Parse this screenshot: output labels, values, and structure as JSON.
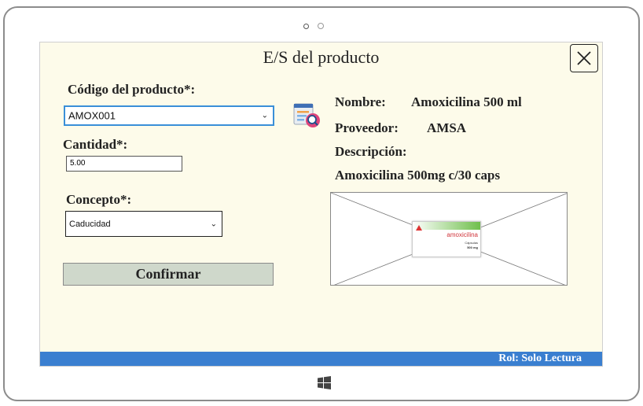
{
  "window": {
    "title": "E/S del producto"
  },
  "form": {
    "product_code_label": "Código del producto*:",
    "product_code_value": "AMOX001",
    "quantity_label": "Cantidad*:",
    "quantity_value": "5.00",
    "concept_label": "Concepto*:",
    "concept_value": "Caducidad",
    "confirm_label": "Confirmar"
  },
  "product": {
    "name_label": "Nombre:",
    "name_value": "Amoxicilina 500 ml",
    "supplier_label": "Proveedor:",
    "supplier_value": "AMSA",
    "description_label": "Descripción:",
    "description_value": "Amoxicilina 500mg c/30 caps",
    "box_brand": "amoxicilina",
    "box_small_1": "Cápsulas",
    "box_small_2": "500 mg"
  },
  "footer": {
    "role": "Rol: Solo Lectura"
  },
  "colors": {
    "screen_bg": "#fdfbea",
    "footer_bar": "#3a7fd0",
    "confirm_bg": "#cfd8cb",
    "code_border": "#3a8fd8"
  },
  "icons": [
    "close-icon",
    "search-document-icon",
    "chevron-down-icon",
    "windows-logo-icon"
  ]
}
